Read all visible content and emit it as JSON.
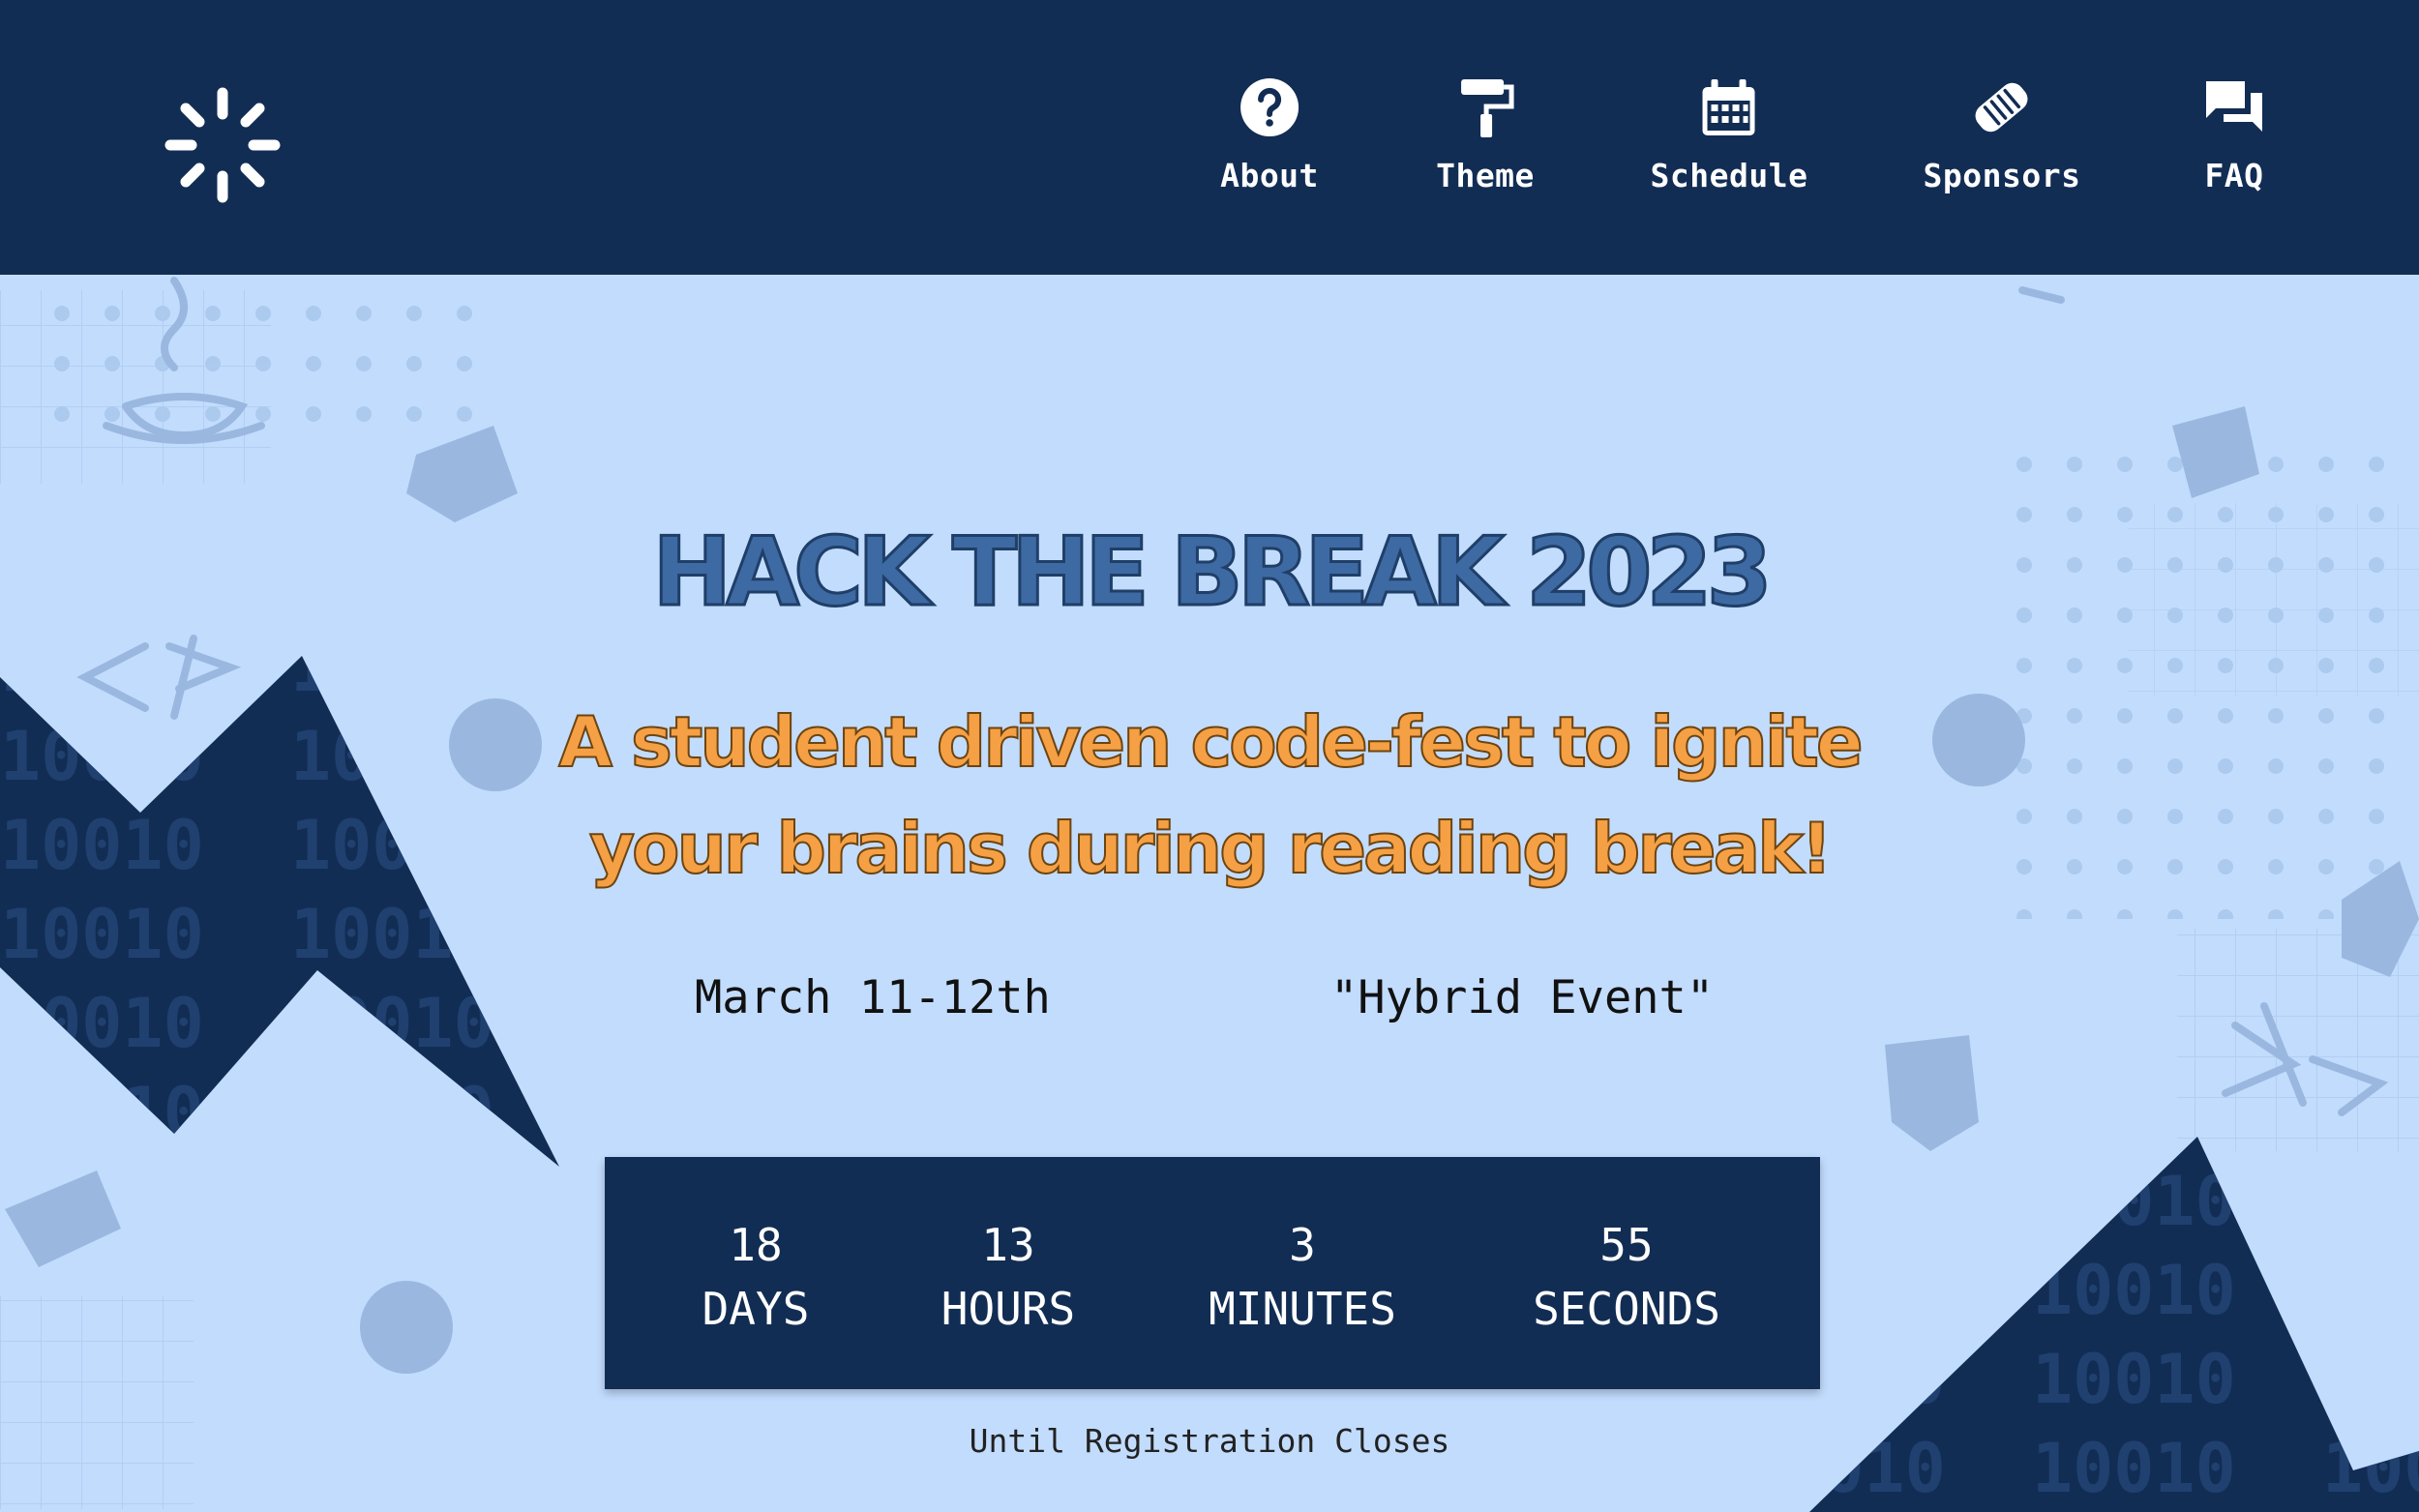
{
  "nav": {
    "items": [
      {
        "label": "About",
        "icon": "question-circle-icon"
      },
      {
        "label": "Theme",
        "icon": "paint-roller-icon"
      },
      {
        "label": "Schedule",
        "icon": "calendar-icon"
      },
      {
        "label": "Sponsors",
        "icon": "handshake-icon"
      },
      {
        "label": "FAQ",
        "icon": "chat-icon"
      }
    ],
    "logo_icon": "loading-spinner-icon"
  },
  "hero": {
    "title": "HACK THE BREAK 2023",
    "tagline_line1": "A student driven code-fest to ignite",
    "tagline_line2": "your brains during reading break!",
    "date": "March 11-12th",
    "format": "\"Hybrid Event\""
  },
  "countdown": {
    "units": [
      {
        "value": "18",
        "label": "DAYS"
      },
      {
        "value": "13",
        "label": "HOURS"
      },
      {
        "value": "3",
        "label": "MINUTES"
      },
      {
        "value": "55",
        "label": "SECONDS"
      }
    ],
    "caption": "Until Registration Closes"
  },
  "colors": {
    "navy": "#122d54",
    "background": "#c2dcfd",
    "title": "#3e6aa3",
    "accent_orange": "#f5a044"
  }
}
